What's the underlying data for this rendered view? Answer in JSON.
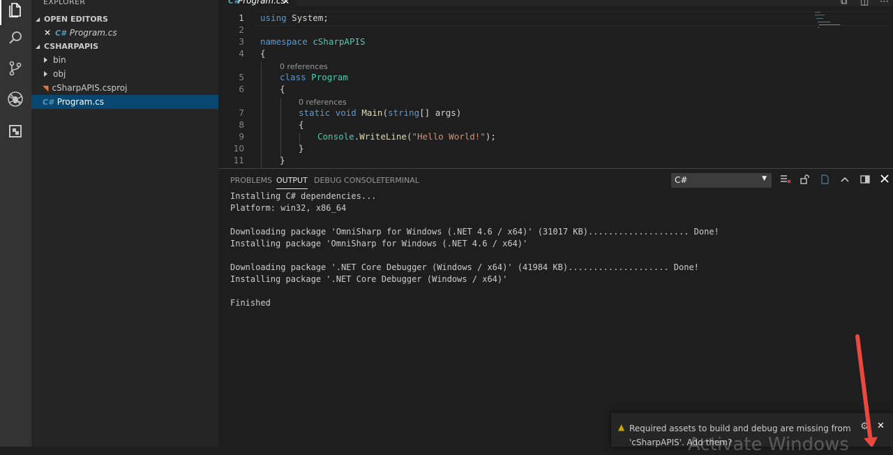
{
  "sidebar": {
    "title": "EXPLORER",
    "open_editors": {
      "header": "OPEN EDITORS",
      "items": [
        {
          "label": "Program.cs"
        }
      ]
    },
    "project": {
      "header": "CSHARPAPIS",
      "items": [
        {
          "label": "bin",
          "kind": "folder"
        },
        {
          "label": "obj",
          "kind": "folder"
        },
        {
          "label": "cSharpAPIS.csproj",
          "kind": "file"
        },
        {
          "label": "Program.cs",
          "kind": "file",
          "selected": true
        }
      ]
    }
  },
  "tab": {
    "label": "Program.cs",
    "close": "✕"
  },
  "editor": {
    "line_numbers": [
      "1",
      "2",
      "3",
      "4",
      "5",
      "6",
      "7",
      "8",
      "9",
      "10",
      "11"
    ],
    "codelens": {
      "class_refs": "0 references",
      "main_refs": "0 references"
    },
    "code": {
      "l1_kw": "using",
      "l1_rest": " System;",
      "l3_kw": "namespace",
      "l3_rest": " cSharpAPIS",
      "brace_open": "{",
      "brace_close": "}",
      "l5_kw": "class",
      "l5_type": "Program",
      "l7_kw1": "static",
      "l7_kw2": "void",
      "l7_fn": "Main",
      "l7_p1": "(",
      "l7_kw3": "string",
      "l7_p2": "[] args)",
      "l9_type": "Console",
      "l9_dot": ".",
      "l9_fn": "WriteLine",
      "l9_p1": "(",
      "l9_str": "\"Hello World!\"",
      "l9_p2": ");"
    }
  },
  "panel": {
    "tabs": [
      "PROBLEMS",
      "OUTPUT",
      "DEBUG CONSOLE",
      "TERMINAL"
    ],
    "active_tab": "OUTPUT",
    "channel": "C#",
    "output_lines": [
      "Installing C# dependencies...",
      "Platform: win32, x86_64",
      "",
      "Downloading package 'OmniSharp for Windows (.NET 4.6 / x64)' (31017 KB).................... Done!",
      "Installing package 'OmniSharp for Windows (.NET 4.6 / x64)'",
      "",
      "Downloading package '.NET Core Debugger (Windows / x64)' (41984 KB).................... Done!",
      "Installing package '.NET Core Debugger (Windows / x64)'",
      "",
      "Finished"
    ]
  },
  "notification": {
    "message": "Required assets to build and debug are missing from 'cSharpAPIS'. Add them?",
    "watermark": "Activate Windows"
  },
  "colors": {
    "activity_bar": "#333333",
    "sidebar": "#252526",
    "editor": "#1e1e1e",
    "selection": "#094771",
    "annotation_arrow": "#e8483f"
  }
}
